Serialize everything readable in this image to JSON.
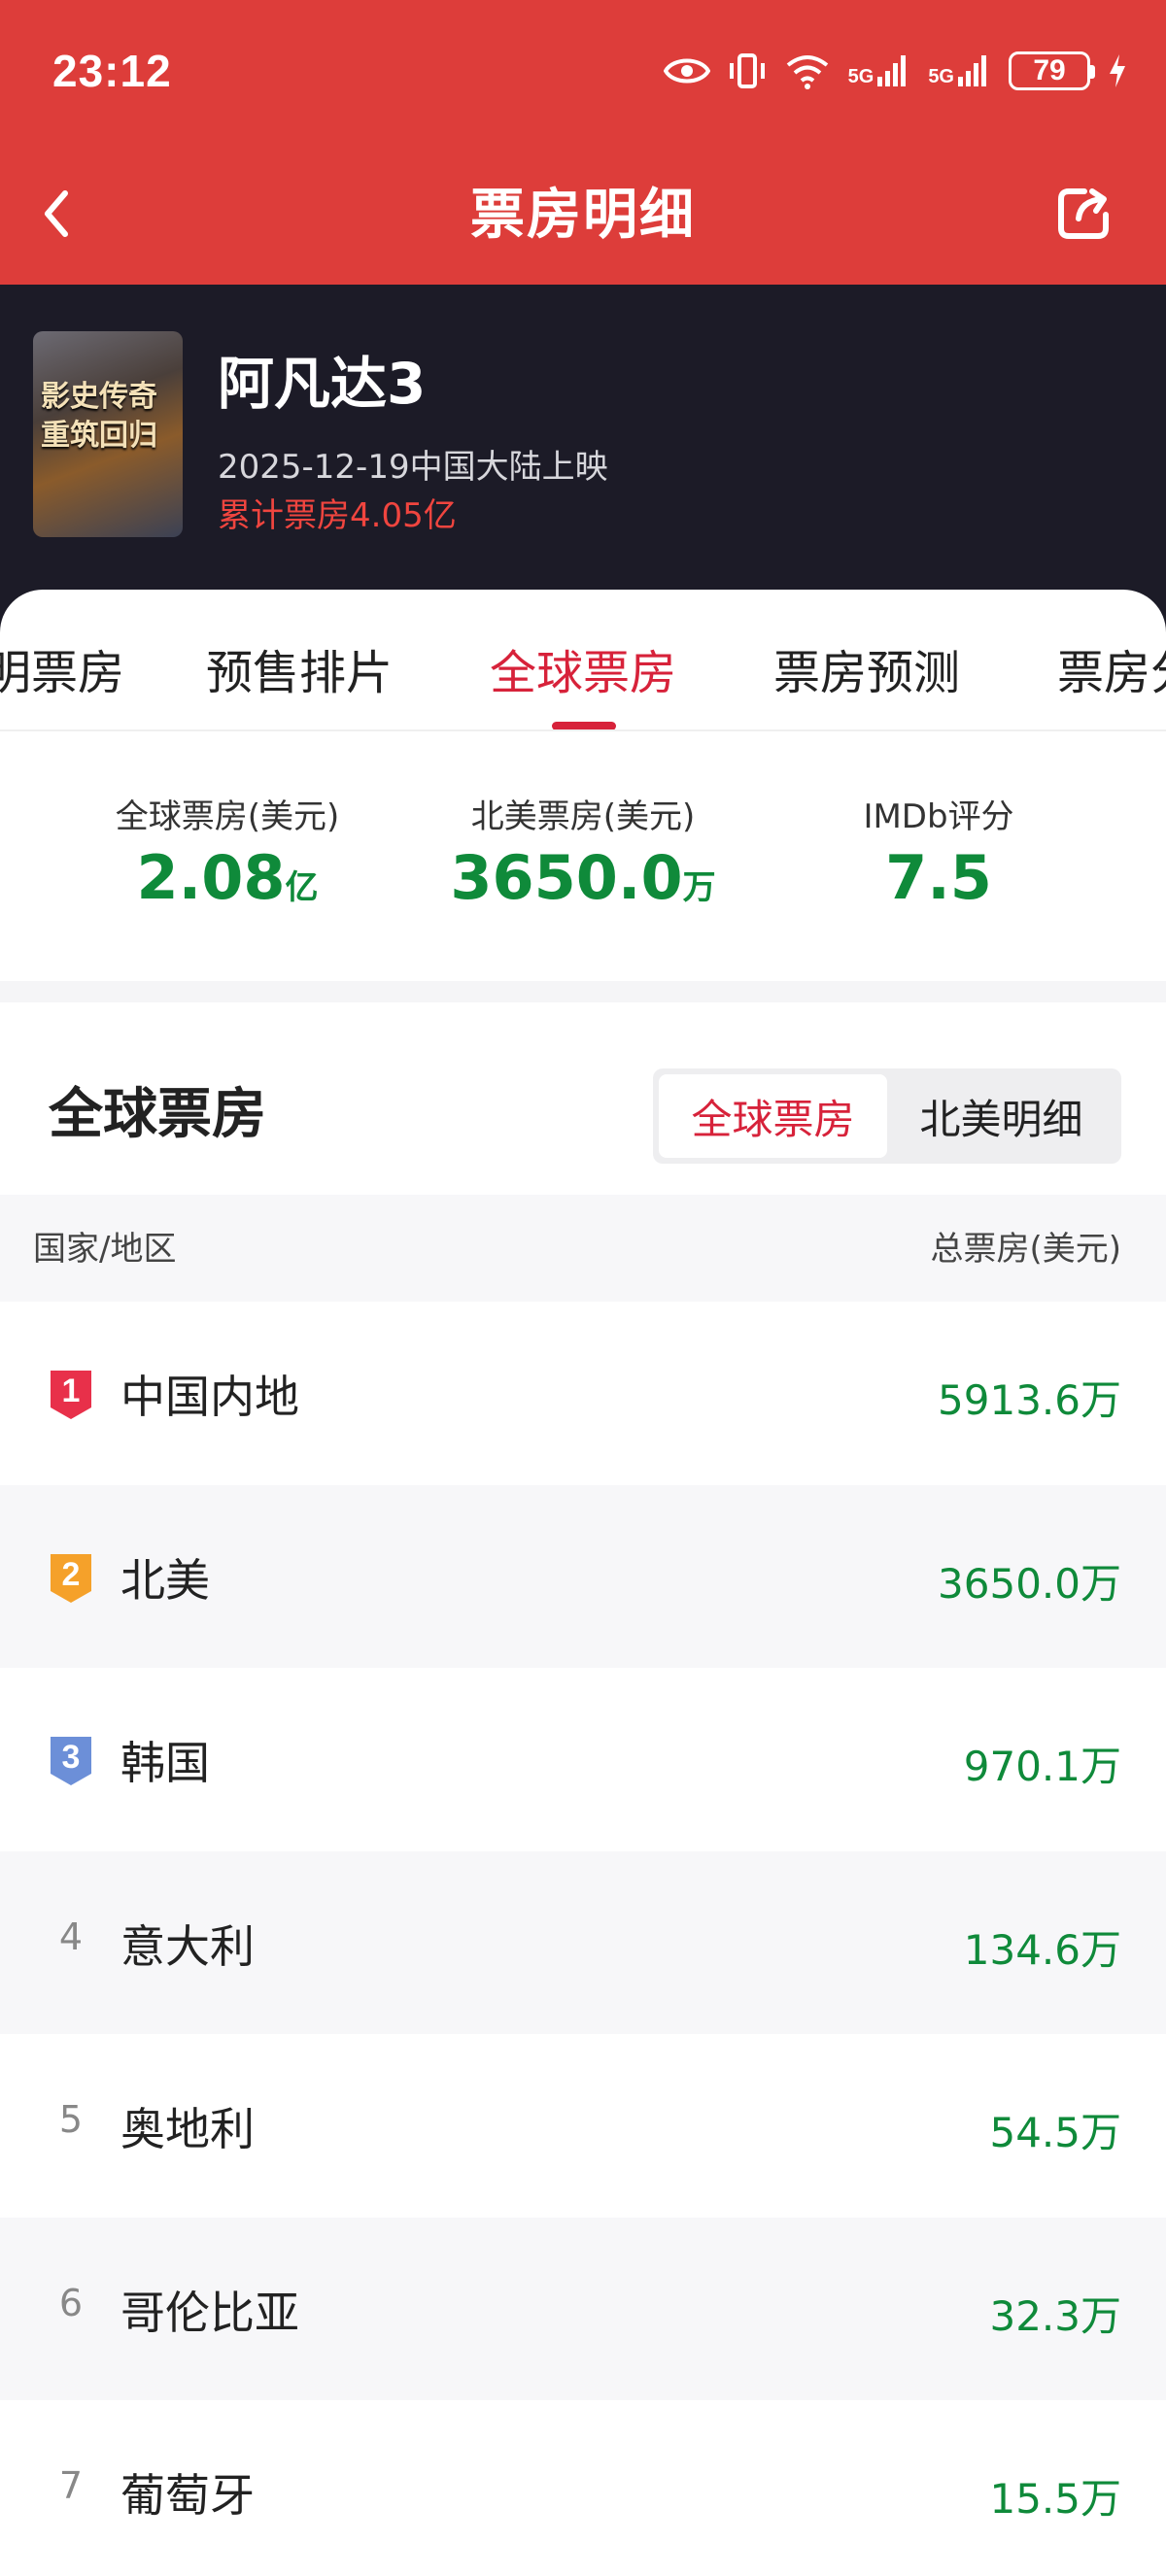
{
  "status_bar": {
    "time": "23:12",
    "net1": "5G",
    "net2": "5G",
    "battery": "79",
    "icons": [
      "eye-icon",
      "vibrate-icon",
      "wifi-icon",
      "signal-icon",
      "signal-icon",
      "battery-icon",
      "charging-icon"
    ]
  },
  "header": {
    "title": "票房明细",
    "back_icon": "chevron-left-icon",
    "share_icon": "share-icon"
  },
  "movie": {
    "poster_text": "影史传奇重筑回归",
    "title": "阿凡达3",
    "release": "2025-12-19中国大陆上映",
    "cumulative": "累计票房4.05亿"
  },
  "tabs": [
    {
      "label": "明票房",
      "active": false
    },
    {
      "label": "预售排片",
      "active": false
    },
    {
      "label": "全球票房",
      "active": true
    },
    {
      "label": "票房预测",
      "active": false
    },
    {
      "label": "票房分",
      "active": false
    }
  ],
  "stats": [
    {
      "label": "全球票房(美元)",
      "value": "2.08",
      "unit": "亿"
    },
    {
      "label": "北美票房(美元)",
      "value": "3650.0",
      "unit": "万"
    },
    {
      "label": "IMDb评分",
      "value": "7.5",
      "unit": ""
    }
  ],
  "section": {
    "title": "全球票房",
    "segments": [
      {
        "label": "全球票房",
        "active": true
      },
      {
        "label": "北美明细",
        "active": false
      }
    ]
  },
  "table": {
    "col_left": "国家/地区",
    "col_right": "总票房(美元)",
    "rows": [
      {
        "rank": "1",
        "country": "中国内地",
        "value": "5913.6万"
      },
      {
        "rank": "2",
        "country": "北美",
        "value": "3650.0万"
      },
      {
        "rank": "3",
        "country": "韩国",
        "value": "970.1万"
      },
      {
        "rank": "4",
        "country": "意大利",
        "value": "134.6万"
      },
      {
        "rank": "5",
        "country": "奥地利",
        "value": "54.5万"
      },
      {
        "rank": "6",
        "country": "哥伦比亚",
        "value": "32.3万"
      },
      {
        "rank": "7",
        "country": "葡萄牙",
        "value": "15.5万"
      }
    ]
  },
  "colors": {
    "header_red": "#dd3d3a",
    "accent_red": "#d7223a",
    "value_green": "#0f8a3a",
    "dark_band": "#1c1b27",
    "badge_gold": "#f5a12a",
    "badge_blue": "#6c8fd8"
  }
}
